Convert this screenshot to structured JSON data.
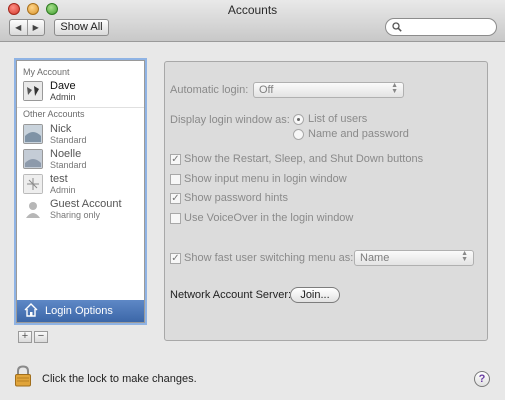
{
  "window": {
    "title": "Accounts"
  },
  "toolbar": {
    "back_icon": "◀",
    "forward_icon": "▶",
    "show_all_label": "Show All",
    "search": {
      "value": "",
      "placeholder": ""
    }
  },
  "sidebar": {
    "my_account_header": "My Account",
    "other_accounts_header": "Other Accounts",
    "my_account": {
      "name": "Dave",
      "role": "Admin"
    },
    "accounts": [
      {
        "name": "Nick",
        "role": "Standard"
      },
      {
        "name": "Noelle",
        "role": "Standard"
      },
      {
        "name": "test",
        "role": "Admin"
      },
      {
        "name": "Guest Account",
        "role": "Sharing only"
      }
    ],
    "login_options_label": "Login Options",
    "add_label": "+",
    "remove_label": "−"
  },
  "panel": {
    "automatic_login_label": "Automatic login:",
    "automatic_login_value": "Off",
    "display_login_label": "Display login window as:",
    "radio_list_label": "List of users",
    "radio_name_label": "Name and password",
    "check_restart_label": "Show the Restart, Sleep, and Shut Down buttons",
    "check_input_menu_label": "Show input menu in login window",
    "check_password_hints_label": "Show password hints",
    "check_voiceover_label": "Use VoiceOver in the login window",
    "fast_switch_label": "Show fast user switching menu as:",
    "fast_switch_value": "Name",
    "network_server_label": "Network Account Server:",
    "join_label": "Join..."
  },
  "footer": {
    "lock_text": "Click the lock to make changes.",
    "help_label": "?"
  },
  "colors": {
    "selection": "#3c67a8",
    "help_accent": "#6b3fa3"
  }
}
